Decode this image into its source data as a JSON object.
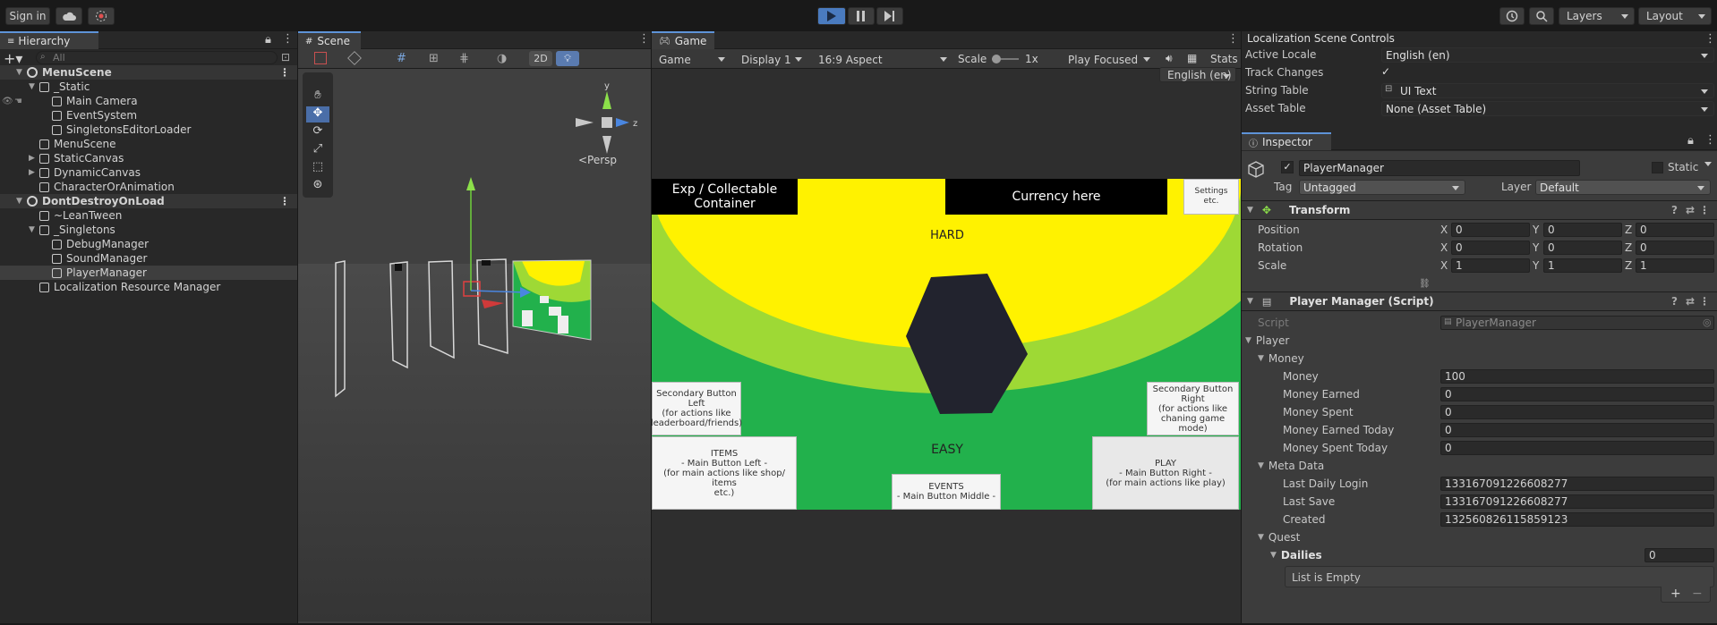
{
  "toolbar": {
    "sign_in": "Sign in",
    "layers": "Layers",
    "layout": "Layout",
    "icons": [
      "cloud-icon",
      "collab-icon",
      "play-icon",
      "pause-icon",
      "step-icon",
      "history-icon",
      "search-icon"
    ]
  },
  "hierarchy": {
    "tab": "Hierarchy",
    "search_placeholder": "All",
    "items": [
      {
        "label": "MenuScene",
        "depth": 0,
        "kind": "scene",
        "fold": "▼"
      },
      {
        "label": "_Static",
        "depth": 1,
        "kind": "object",
        "fold": "▼"
      },
      {
        "label": "Main Camera",
        "depth": 2,
        "kind": "object",
        "fold": ""
      },
      {
        "label": "EventSystem",
        "depth": 2,
        "kind": "object",
        "fold": ""
      },
      {
        "label": "SingletonsEditorLoader",
        "depth": 2,
        "kind": "object",
        "fold": ""
      },
      {
        "label": "MenuScene",
        "depth": 1,
        "kind": "object",
        "fold": ""
      },
      {
        "label": "StaticCanvas",
        "depth": 1,
        "kind": "object",
        "fold": "▶"
      },
      {
        "label": "DynamicCanvas",
        "depth": 1,
        "kind": "object",
        "fold": "▶"
      },
      {
        "label": "CharacterOrAnimation",
        "depth": 1,
        "kind": "object",
        "fold": ""
      },
      {
        "label": "DontDestroyOnLoad",
        "depth": 0,
        "kind": "scene",
        "fold": "▼"
      },
      {
        "label": "~LeanTween",
        "depth": 1,
        "kind": "object",
        "fold": ""
      },
      {
        "label": "_Singletons",
        "depth": 1,
        "kind": "object",
        "fold": "▼"
      },
      {
        "label": "DebugManager",
        "depth": 2,
        "kind": "object",
        "fold": ""
      },
      {
        "label": "SoundManager",
        "depth": 2,
        "kind": "object",
        "fold": ""
      },
      {
        "label": "PlayerManager",
        "depth": 2,
        "kind": "object",
        "fold": "",
        "selected": true
      },
      {
        "label": "Localization Resource Manager",
        "depth": 1,
        "kind": "object",
        "fold": ""
      }
    ]
  },
  "scene": {
    "tab": "Scene",
    "btn_2d": "2D",
    "persp": "<Persp",
    "axis_y": "y",
    "axis_z": "z"
  },
  "game": {
    "tab": "Game",
    "mode": "Game",
    "display": "Display 1",
    "aspect": "16:9 Aspect",
    "scale_label": "Scale",
    "scale_value": "1x",
    "play_focused": "Play Focused",
    "stats": "Stats",
    "locale": "English (en)",
    "exp_label": "Exp / Collectable\nContainer",
    "currency_label": "Currency here",
    "settings_label": "Settings\netc.",
    "hard": "HARD",
    "easy": "EASY",
    "secondary_left": "Secondary Button Left\n(for actions like\nleaderboard/friends)",
    "secondary_right": "Secondary Button\nRight\n(for actions like\nchaning game mode)",
    "items_btn": "ITEMS\n- Main Button Left -\n(for main actions like shop/ items\netc.)",
    "events_btn": "EVENTS\n- Main Button Middle -",
    "play_btn": "PLAY\n- Main Button Right -\n(for main actions like play)",
    "colors": {
      "yellow": "#fff200",
      "lime": "#9ed935",
      "green": "#22b14c",
      "hex": "#22232e"
    }
  },
  "localization": {
    "title": "Localization Scene Controls",
    "active_locale_label": "Active Locale",
    "active_locale": "English (en)",
    "track_changes_label": "Track Changes",
    "track_changes_check": "✓",
    "string_table_label": "String Table",
    "string_table": "UI Text",
    "asset_table_label": "Asset Table",
    "asset_table": "None (Asset Table)"
  },
  "inspector": {
    "tab": "Inspector",
    "object_name": "PlayerManager",
    "active_check": "✓",
    "static_label": "Static",
    "tag_label": "Tag",
    "tag": "Untagged",
    "layer_label": "Layer",
    "layer": "Default",
    "transform": {
      "title": "Transform",
      "rows": [
        {
          "label": "Position",
          "x": "0",
          "y": "0",
          "z": "0"
        },
        {
          "label": "Rotation",
          "x": "0",
          "y": "0",
          "z": "0"
        },
        {
          "label": "Scale",
          "x": "1",
          "y": "1",
          "z": "1"
        }
      ],
      "x": "X",
      "y": "Y",
      "z": "Z"
    },
    "script": {
      "title": "Player Manager (Script)",
      "script_label": "Script",
      "script_value": "PlayerManager",
      "player": "Player",
      "money_group": "Money",
      "money_rows": [
        {
          "label": "Money",
          "value": "100"
        },
        {
          "label": "Money Earned",
          "value": "0"
        },
        {
          "label": "Money Spent",
          "value": "0"
        },
        {
          "label": "Money Earned Today",
          "value": "0"
        },
        {
          "label": "Money Spent Today",
          "value": "0"
        }
      ],
      "meta_group": "Meta Data",
      "meta_rows": [
        {
          "label": "Last Daily Login",
          "value": "133167091226608277"
        },
        {
          "label": "Last Save",
          "value": "133167091226608277"
        },
        {
          "label": "Created",
          "value": "132560826115859123"
        }
      ],
      "quest_group": "Quest",
      "dailies_label": "Dailies",
      "dailies_count": "0",
      "list_empty": "List is Empty",
      "plus": "+",
      "minus": "−"
    }
  }
}
